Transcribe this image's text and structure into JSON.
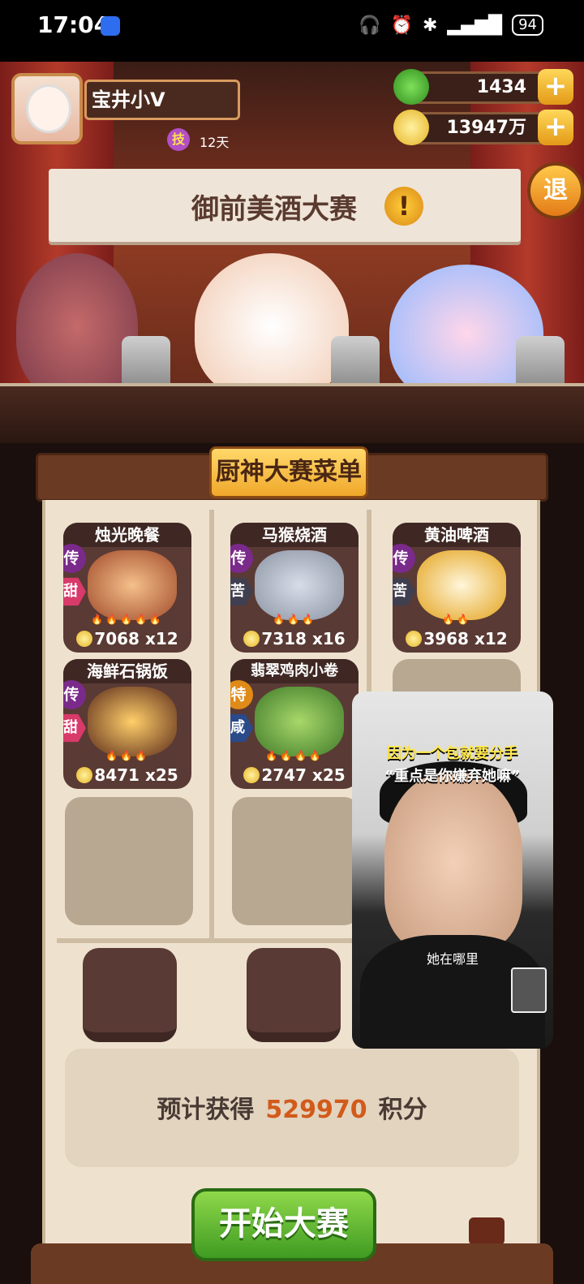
{
  "status_bar": {
    "time": "17:04",
    "battery": "94"
  },
  "player": {
    "name": "宝井小V",
    "skill_badge": "技",
    "days": "12天"
  },
  "resources": {
    "gems": "1434",
    "coins": "13947万",
    "plus": "+"
  },
  "exit_label": "退",
  "event_banner": {
    "title": "御前美酒大赛",
    "warn_symbol": "!"
  },
  "menu": {
    "title": "厨神大赛菜单"
  },
  "dishes": [
    {
      "name": "烛光晚餐",
      "rank": "传",
      "taste": "甜",
      "points": "7068",
      "count": "x12"
    },
    {
      "name": "马猴烧酒",
      "rank": "传",
      "taste": "苦",
      "points": "7318",
      "count": "x16"
    },
    {
      "name": "黄油啤酒",
      "rank": "传",
      "taste": "苦",
      "points": "3968",
      "count": "x12"
    },
    {
      "name": "海鲜石锅饭",
      "rank": "传",
      "taste": "甜",
      "points": "8471",
      "count": "x25"
    },
    {
      "name": "翡翠鸡肉小卷",
      "rank": "特",
      "taste": "咸",
      "points": "2747",
      "count": "x25"
    }
  ],
  "score": {
    "prefix": "预计获得",
    "value": "529970",
    "suffix": "积分"
  },
  "start_button": "开始大赛",
  "video_overlay": {
    "caption_line1": "因为一个包就要分手",
    "caption_line2": "“重点是你嫌弃她嘛”",
    "subtitle": "她在哪里"
  },
  "colors": {
    "rank_legend": "#7a2a8a",
    "rank_special": "#e08a17",
    "taste_sweet": "#d83a6a",
    "taste_bitter": "#3f3f4f",
    "taste_salty": "#2a4a8a"
  }
}
